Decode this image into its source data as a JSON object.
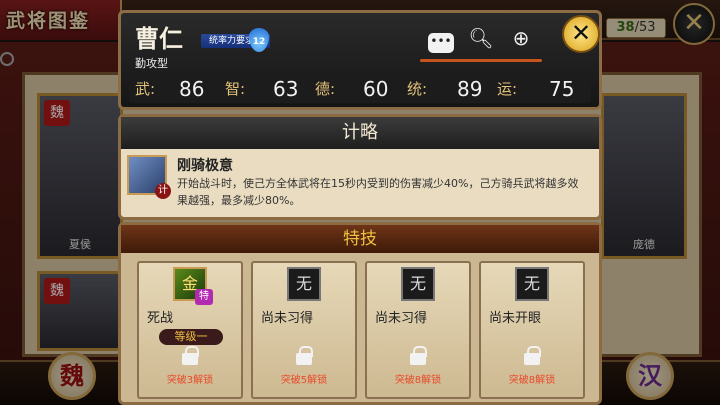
{
  "background": {
    "title": "武将图鉴",
    "counter": {
      "current": "38",
      "total": "/53"
    },
    "cards": [
      {
        "kingdom": "魏",
        "name": "夏侯"
      },
      {
        "kingdom": "魏",
        "name": ""
      },
      {
        "kingdom": "",
        "name": "庞德"
      }
    ],
    "bottom_left_kingdom": "魏",
    "bottom_right_kingdom": "汉"
  },
  "general": {
    "name": "曹仁",
    "rank_label": "统率力要求",
    "rank_value": "12",
    "type": "勤攻型",
    "stats": [
      {
        "label": "武:",
        "value": "86"
      },
      {
        "label": "智:",
        "value": "63"
      },
      {
        "label": "德:",
        "value": "60"
      },
      {
        "label": "统:",
        "value": "89"
      },
      {
        "label": "运:",
        "value": "75"
      }
    ]
  },
  "strategy": {
    "title": "计略",
    "icon_tag": "计",
    "name": "刚骑极意",
    "description": "开始战斗时，使己方全体武将在15秒内受到的伤害减少40%，己方骑兵武将越多效果越强，最多减少80%。"
  },
  "skills": {
    "title": "特技",
    "slots": [
      {
        "icon": "金",
        "tag": "特",
        "name": "死战",
        "level": "等级一",
        "unlock": "突破3解锁"
      },
      {
        "icon": "无",
        "tag": "",
        "name": "尚未习得",
        "level": "",
        "unlock": "突破5解锁"
      },
      {
        "icon": "无",
        "tag": "",
        "name": "尚未习得",
        "level": "",
        "unlock": "突破8解锁"
      },
      {
        "icon": "无",
        "tag": "",
        "name": "尚未开眼",
        "level": "",
        "unlock": "突破8解锁"
      }
    ]
  },
  "icons": {
    "close": "close-icon",
    "chat": "chat-icon",
    "search": "magnifier-icon",
    "add": "add-item-icon",
    "lock": "lock-icon"
  },
  "colors": {
    "accent_gold": "#f0c040",
    "unlock_red": "#e84a2a",
    "stat_label": "#e4c27a"
  }
}
